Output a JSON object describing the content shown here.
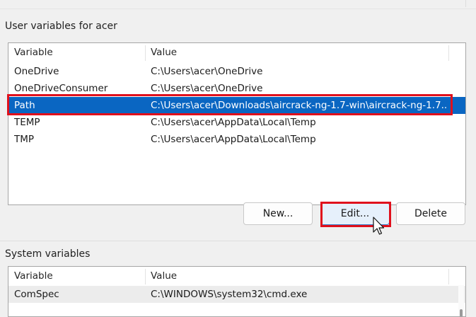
{
  "user_vars": {
    "title": "User variables for acer",
    "columns": [
      "Variable",
      "Value"
    ],
    "rows": [
      {
        "variable": "OneDrive",
        "value": "C:\\Users\\acer\\OneDrive"
      },
      {
        "variable": "OneDriveConsumer",
        "value": "C:\\Users\\acer\\OneDrive"
      },
      {
        "variable": "Path",
        "value": "C:\\Users\\acer\\Downloads\\aircrack-ng-1.7-win\\aircrack-ng-1.7..."
      },
      {
        "variable": "TEMP",
        "value": "C:\\Users\\acer\\AppData\\Local\\Temp"
      },
      {
        "variable": "TMP",
        "value": "C:\\Users\\acer\\AppData\\Local\\Temp"
      }
    ],
    "selected_row": "Path",
    "buttons": {
      "new": "New...",
      "edit": "Edit...",
      "delete": "Delete"
    }
  },
  "system_vars": {
    "title": "System variables",
    "columns": [
      "Variable",
      "Value"
    ],
    "rows": [
      {
        "variable": "ComSpec",
        "value": "C:\\WINDOWS\\system32\\cmd.exe"
      }
    ]
  },
  "colors": {
    "selection": "#0a66c2",
    "highlight_box": "#e0101c",
    "focused_button": "#e6f0fb"
  }
}
